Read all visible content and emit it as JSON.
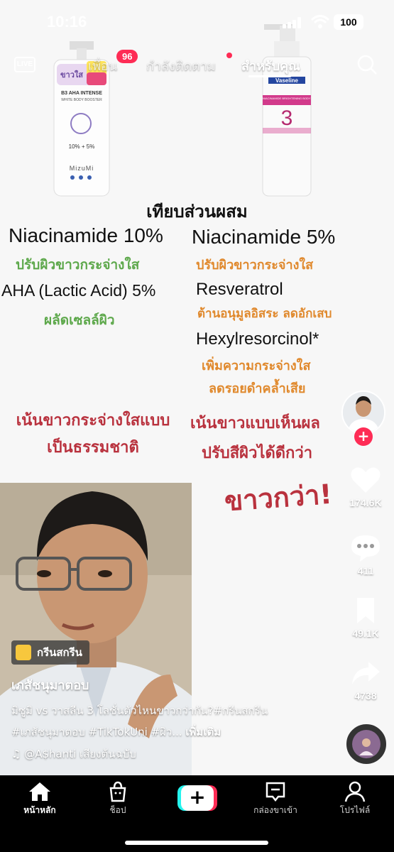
{
  "status": {
    "time": "10:16",
    "battery": "100"
  },
  "topnav": {
    "live": "LIVE",
    "tabs": [
      {
        "label": "เพื่อน",
        "active": false
      },
      {
        "label": "กำลังติดตาม",
        "active": false
      },
      {
        "label": "สำหรับคุณ",
        "active": true
      }
    ],
    "friends_badge": "96"
  },
  "video": {
    "products": {
      "left_brand": "MizuMi",
      "left_line1": "B3 AHA INTENSE",
      "left_line2": "WHITE BODY BOOSTER",
      "left_pill": "ขาวใส",
      "left_numbers": "10% + 5%",
      "right_brand": "Vaseline",
      "right_number": "3",
      "right_line": "NIACINAMIDE BRIGHTENING BODY LOTION"
    },
    "compare_title": "เทียบส่วนผสม",
    "left_col": {
      "ing1": "Niacinamide 10%",
      "desc1": "ปรับผิวขาวกระจ่างใส",
      "ing2": "AHA (Lactic Acid) 5%",
      "desc2": "ผลัดเซลล์ผิว",
      "summary1": "เน้นขาวกระจ่างใสแบบ",
      "summary2": "เป็นธรรมชาติ"
    },
    "right_col": {
      "ing1": "Niacinamide 5%",
      "desc1": "ปรับผิวขาวกระจ่างใส",
      "ing2": "Resveratrol",
      "desc2": "ต้านอนุมูลอิสระ ลดอักเสบ",
      "ing3": "Hexylresorcinol*",
      "desc3a": "เพิ่มความกระจ่างใส",
      "desc3b": "ลดรอยดำคล้ำเสีย",
      "summary1": "เน้นขาวแบบเห็นผล",
      "summary2": "ปรับสีผิวได้ดีกว่า",
      "big": "ขาวกว่า!"
    }
  },
  "rail": {
    "likes": "174.6K",
    "comments": "411",
    "saves": "49.1K",
    "shares": "4738"
  },
  "caption": {
    "tag": "กรีนสกรีน",
    "author": "เภสัชนุมาตอบ",
    "text": "มิซูมิ vs วาสลีน 3 โลชั่นตัวไหนขาวกว่ากัน?#กรีนสกรีน #เภสัชนุมาตอบ #TikTokUni #ผิว...",
    "more": "เพิ่มเติม",
    "music": "@A$hanti เสียงต้นฉบับ"
  },
  "bottomnav": {
    "home": "หน้าหลัก",
    "shop": "ช็อป",
    "inbox": "กล่องขาเข้า",
    "profile": "โปรไฟล์"
  },
  "colors": {
    "accent": "#fe2c55",
    "cyan": "#25f4ee",
    "green_text": "#5da84b",
    "orange_text": "#e0892d",
    "red_text": "#b9323e"
  }
}
